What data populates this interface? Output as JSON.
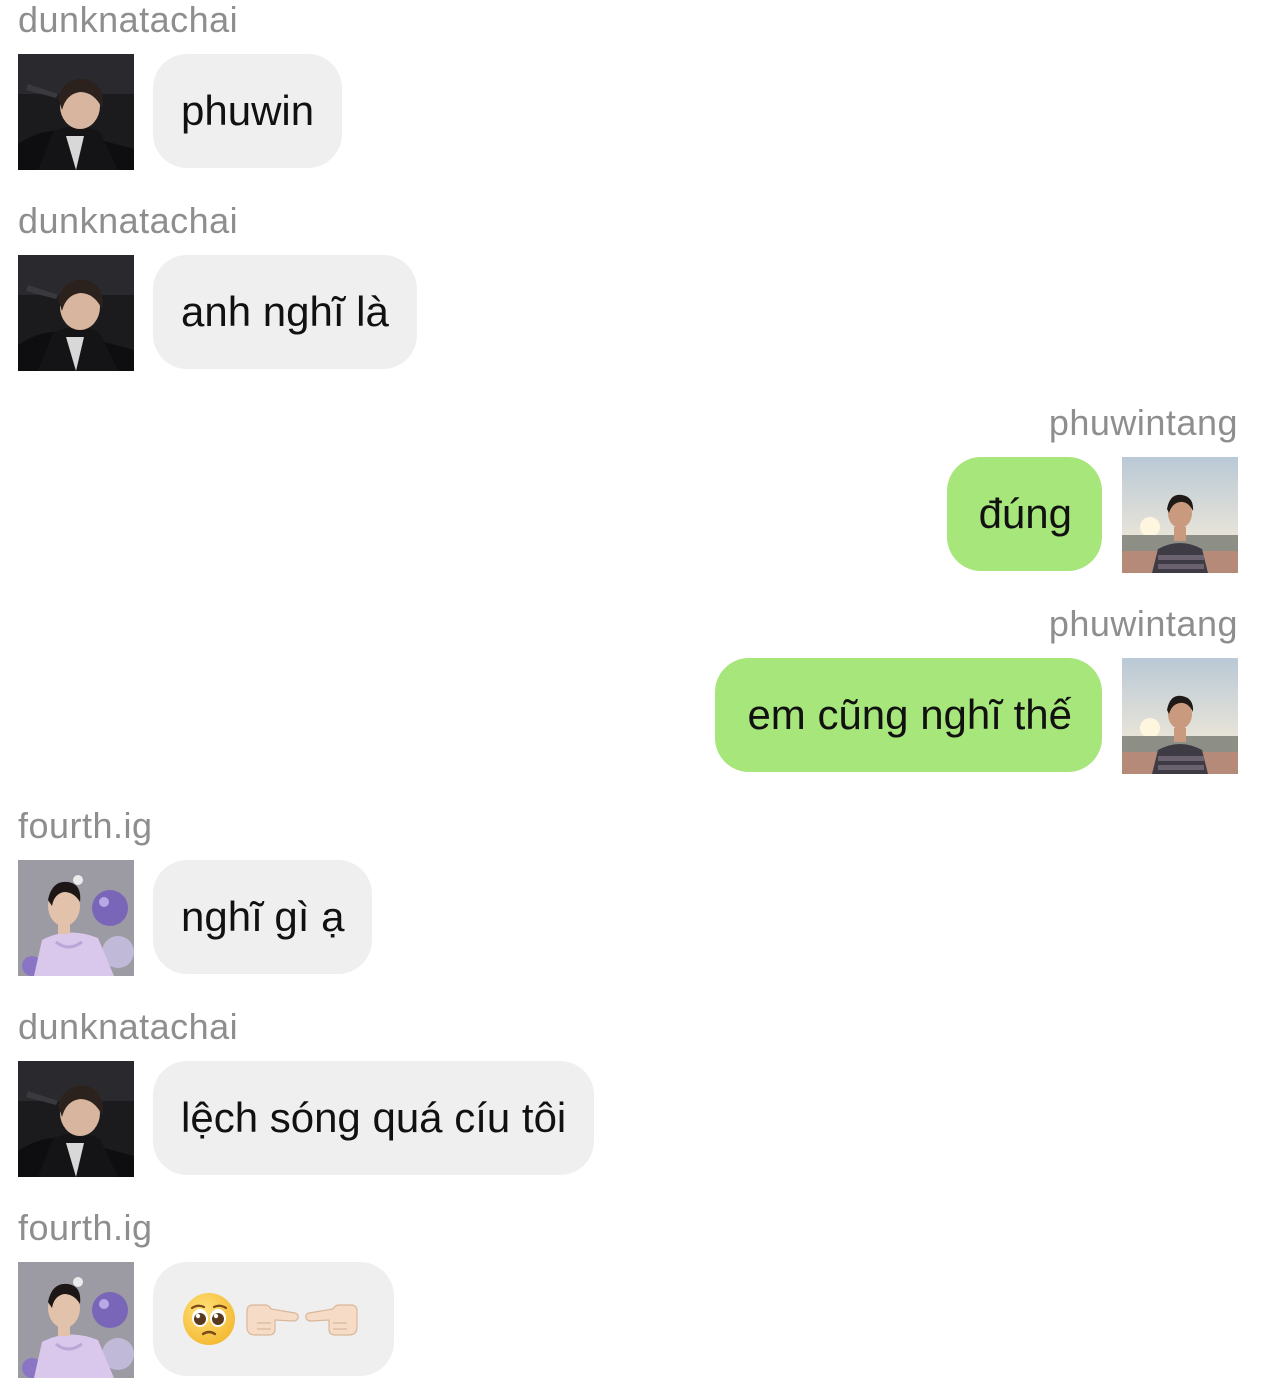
{
  "messages": [
    {
      "sender": "dunknatachai",
      "text": "phuwin",
      "side": "left",
      "avatar": "dunk-avatar"
    },
    {
      "sender": "dunknatachai",
      "text": "anh nghĩ là",
      "side": "left",
      "avatar": "dunk-avatar"
    },
    {
      "sender": "phuwintang",
      "text": "đúng",
      "side": "right",
      "avatar": "phuwin-avatar"
    },
    {
      "sender": "phuwintang",
      "text": "em cũng nghĩ thế",
      "side": "right",
      "avatar": "phuwin-avatar"
    },
    {
      "sender": "fourth.ig",
      "text": "nghĩ gì ạ",
      "side": "left",
      "avatar": "fourth-avatar"
    },
    {
      "sender": "dunknatachai",
      "text": "lệch sóng quá cíu tôi",
      "side": "left",
      "avatar": "dunk-avatar"
    },
    {
      "sender": "fourth.ig",
      "emoji": [
        "pleading-face-icon",
        "hand-pointing-right-icon",
        "hand-pointing-left-icon"
      ],
      "side": "left",
      "avatar": "fourth-avatar"
    }
  ],
  "colors": {
    "incoming_bubble": "#efefef",
    "outgoing_bubble": "#a7e67a",
    "username": "#8e8e8e",
    "text": "#111111"
  }
}
